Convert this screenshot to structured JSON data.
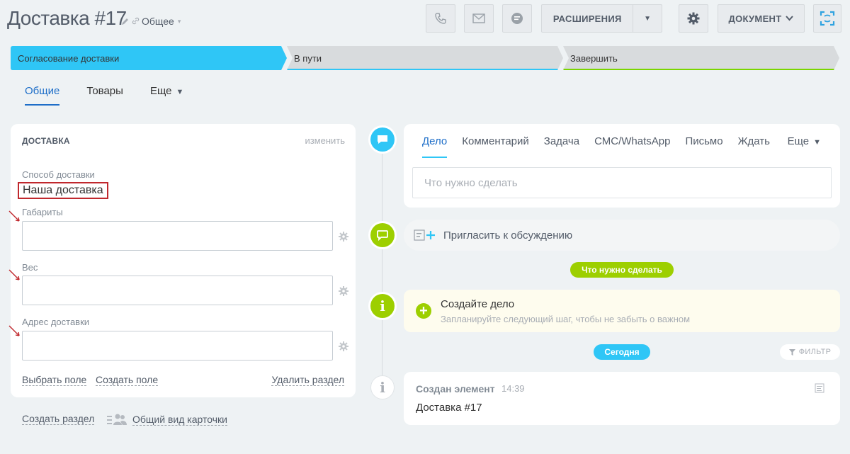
{
  "header": {
    "title": "Доставка #17",
    "link_label": "Общее",
    "extensions_label": "РАСШИРЕНИЯ",
    "document_label": "ДОКУМЕНТ"
  },
  "stages": [
    {
      "label": "Согласование доставки",
      "color": "#2fc6f6"
    },
    {
      "label": "В пути",
      "color": "#d8dbdd"
    },
    {
      "label": "Завершить",
      "color": "#d8dbdd"
    }
  ],
  "tabs": [
    {
      "label": "Общие"
    },
    {
      "label": "Товары"
    },
    {
      "label": "Еще"
    }
  ],
  "card": {
    "title": "ДОСТАВКА",
    "change_label": "изменить",
    "delivery_method_label": "Способ доставки",
    "delivery_method_value": "Наша доставка",
    "dimensions_label": "Габариты",
    "weight_label": "Вес",
    "address_label": "Адрес доставки",
    "select_field": "Выбрать поле",
    "create_field": "Создать поле",
    "delete_section": "Удалить раздел"
  },
  "footer_links": {
    "create_section": "Создать раздел",
    "card_view": "Общий вид карточки"
  },
  "composer": {
    "tabs": [
      "Дело",
      "Комментарий",
      "Задача",
      "СМС/WhatsApp",
      "Письмо",
      "Ждать"
    ],
    "more_label": "Еще",
    "placeholder": "Что нужно сделать"
  },
  "invite_label": "Пригласить к обсуждению",
  "todo_pill": "Что нужно сделать",
  "create_task": {
    "title": "Создайте дело",
    "subtitle": "Запланируйте следующий шаг, чтобы не забыть о важном"
  },
  "today_pill": "Сегодня",
  "filter_label": "ФИЛЬТР",
  "entry": {
    "title": "Создан элемент",
    "time": "14:39",
    "body": "Доставка #17"
  },
  "colors": {
    "accent_blue": "#2fc6f6",
    "accent_green": "#9dcf00",
    "link_blue": "#1e6ec8",
    "highlight_red": "#c0282d"
  }
}
